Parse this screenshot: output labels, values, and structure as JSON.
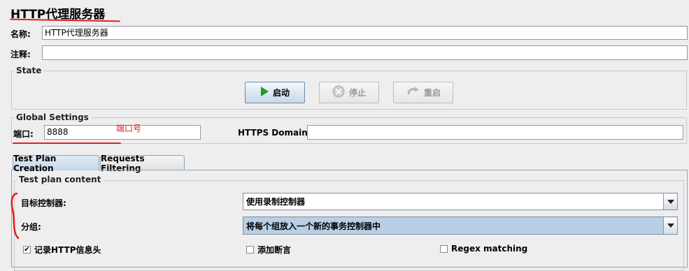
{
  "panel": {
    "title": "HTTP代理服务器"
  },
  "name_field": {
    "label": "名称:",
    "value": "HTTP代理服务器"
  },
  "comment_field": {
    "label": "注释:",
    "value": ""
  },
  "state": {
    "title": "State",
    "start_label": "启动",
    "stop_label": "停止",
    "restart_label": "重启"
  },
  "global": {
    "title": "Global Settings",
    "port_label": "端口:",
    "port_value": "8888",
    "port_annotation": "端口号",
    "https_label": "HTTPS Domains:",
    "https_value": ""
  },
  "tabs": [
    {
      "label": "Test Plan Creation",
      "selected": true
    },
    {
      "label": "Requests Filtering",
      "selected": false
    }
  ],
  "test_plan": {
    "title": "Test plan content",
    "target_label": "目标控制器:",
    "target_value": "使用录制控制器",
    "grouping_label": "分组:",
    "grouping_value": "将每个组放入一个新的事务控制器中",
    "checkboxes": [
      {
        "label": "记录HTTP信息头",
        "checked": true
      },
      {
        "label": "添加断言",
        "checked": false
      },
      {
        "label": "Regex matching",
        "checked": false
      }
    ]
  },
  "colors": {
    "annotation_red": "#e02020",
    "start_icon_green": "#1f9a2c",
    "background": "#eeeeee"
  }
}
